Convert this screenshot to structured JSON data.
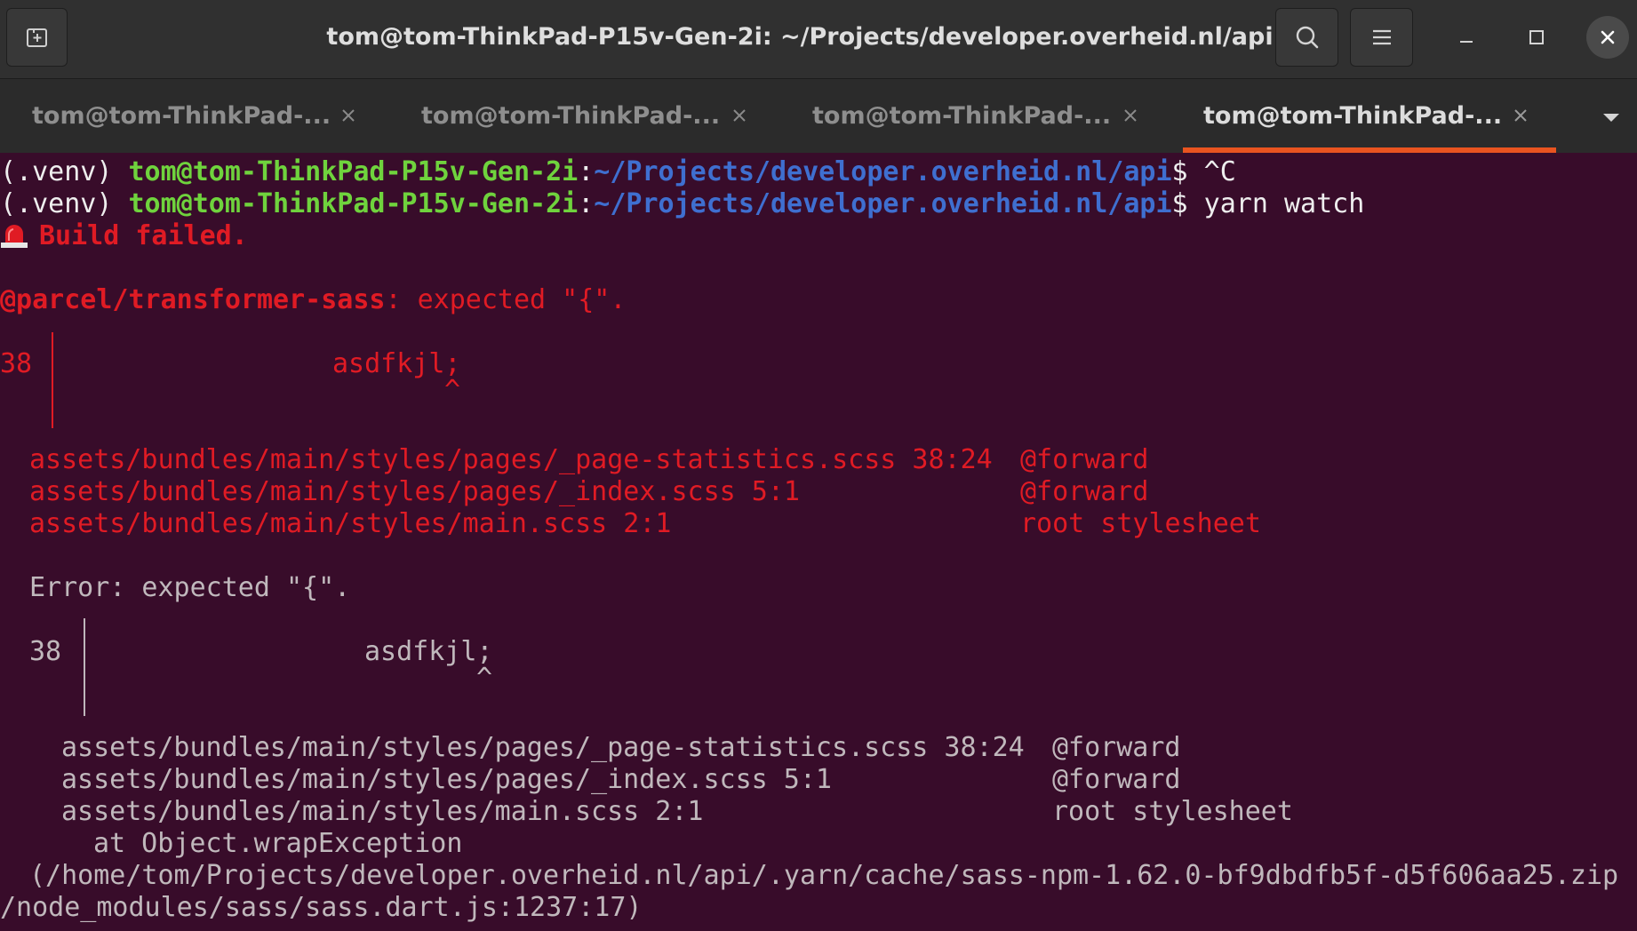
{
  "window": {
    "title": "tom@tom-ThinkPad-P15v-Gen-2i: ~/Projects/developer.overheid.nl/api"
  },
  "tabs": [
    {
      "label": "tom@tom-ThinkPad-...",
      "active": false
    },
    {
      "label": "tom@tom-ThinkPad-...",
      "active": false
    },
    {
      "label": "tom@tom-ThinkPad-...",
      "active": false
    },
    {
      "label": "tom@tom-ThinkPad-...",
      "active": true
    }
  ],
  "colors": {
    "terminal_bg": "#380c2a",
    "prompt_user": "#6fd33d",
    "prompt_path": "#3f6fd0",
    "error_red": "#e01b24",
    "active_tab_indicator": "#e95420"
  },
  "icons": {
    "new_tab": "new-tab-icon",
    "search": "search-icon",
    "menu": "hamburger-menu-icon",
    "minimize": "minimize-icon",
    "maximize": "maximize-icon",
    "close": "close-icon",
    "tab_close": "close-icon",
    "tab_list": "chevron-down-icon",
    "build_failed": "alarm-light-icon"
  },
  "terminal": {
    "prompt1": {
      "venv": "(.venv) ",
      "user": "tom@tom-ThinkPad-P15v-Gen-2i",
      "colon": ":",
      "path": "~/Projects/developer.overheid.nl/api",
      "dollar": "$ ",
      "command": "^C"
    },
    "prompt2": {
      "venv": "(.venv) ",
      "user": "tom@tom-ThinkPad-P15v-Gen-2i",
      "colon": ":",
      "path": "~/Projects/developer.overheid.nl/api",
      "dollar": "$ ",
      "command": "yarn watch"
    },
    "build_failed": "Build failed.",
    "transformer_name": "@parcel/transformer-sass",
    "transformer_msg": ": expected \"{\".",
    "snippet1_line_no": "38",
    "snippet1_code": "asdfkjl;",
    "snippet1_caret": "^",
    "trace1": [
      {
        "file": "assets/bundles/main/styles/pages/_page-statistics.scss 38:24",
        "kind": "@forward"
      },
      {
        "file": "assets/bundles/main/styles/pages/_index.scss 5:1",
        "kind": "@forward"
      },
      {
        "file": "assets/bundles/main/styles/main.scss 2:1",
        "kind": "root stylesheet"
      }
    ],
    "error_msg": "Error: expected \"{\".",
    "snippet2_line_no": "38",
    "snippet2_code": "asdfkjl;",
    "snippet2_caret": "^",
    "trace2": [
      {
        "file": "assets/bundles/main/styles/pages/_page-statistics.scss 38:24",
        "kind": "@forward"
      },
      {
        "file": "assets/bundles/main/styles/pages/_index.scss 5:1",
        "kind": "@forward"
      },
      {
        "file": "assets/bundles/main/styles/main.scss 2:1",
        "kind": "root stylesheet"
      }
    ],
    "at_line": "at Object.wrapException",
    "path_line1": "(/home/tom/Projects/developer.overheid.nl/api/.yarn/cache/sass-npm-1.62.0-bf9dbdfb5f-d5f606aa25.zip",
    "path_line2": "/node_modules/sass/sass.dart.js:1237:17)"
  }
}
